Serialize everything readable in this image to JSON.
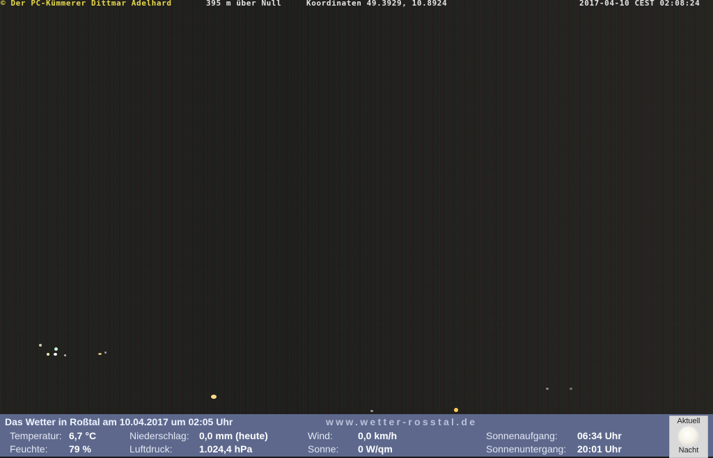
{
  "webcam_overlay": {
    "credit": "© Der PC-Kümmerer Dittmar Adelhard",
    "altitude": "395 m über Null",
    "coordinates": "Koordinaten 49.3929, 10.8924",
    "timestamp": "2017-04-10 CEST 02:08:24"
  },
  "weather": {
    "title": "Das Wetter in Roßtal am 10.04.2017 um 02:05 Uhr",
    "site": "www.wetter-rosstal.de",
    "temperature_label": "Temperatur:",
    "temperature_value": "6,7 °C",
    "humidity_label": "Feuchte:",
    "humidity_value": "79 %",
    "precipitation_label": "Niederschlag:",
    "precipitation_value": "0,0 mm (heute)",
    "pressure_label": "Luftdruck:",
    "pressure_value": "1.024,4 hPa",
    "wind_label": "Wind:",
    "wind_value": "0,0 km/h",
    "sun_label": "Sonne:",
    "sun_value": "0 W/qm",
    "sunrise_label": "Sonnenaufgang:",
    "sunrise_value": "06:34 Uhr",
    "sunset_label": "Sonnenuntergang:",
    "sunset_value": "20:01 Uhr"
  },
  "moon_box": {
    "top_label": "Aktuell",
    "bottom_label": "Nacht",
    "icon": "moon-icon"
  }
}
